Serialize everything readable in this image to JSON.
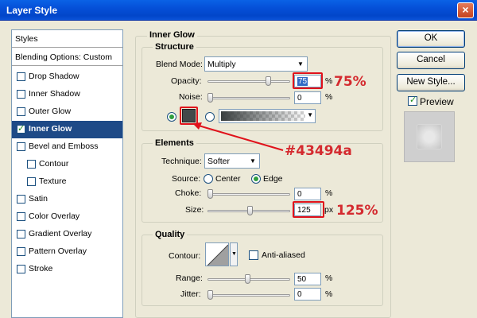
{
  "window": {
    "title": "Layer Style",
    "close_glyph": "×"
  },
  "sidebar": {
    "header": "Styles",
    "blending": "Blending Options: Custom",
    "items": [
      {
        "label": "Drop Shadow",
        "checked": false
      },
      {
        "label": "Inner Shadow",
        "checked": false
      },
      {
        "label": "Outer Glow",
        "checked": false
      },
      {
        "label": "Inner Glow",
        "checked": true
      },
      {
        "label": "Bevel and Emboss",
        "checked": false
      },
      {
        "label": "Contour",
        "checked": false
      },
      {
        "label": "Texture",
        "checked": false
      },
      {
        "label": "Satin",
        "checked": false
      },
      {
        "label": "Color Overlay",
        "checked": false
      },
      {
        "label": "Gradient Overlay",
        "checked": false
      },
      {
        "label": "Pattern Overlay",
        "checked": false
      },
      {
        "label": "Stroke",
        "checked": false
      }
    ]
  },
  "inner_glow": {
    "title": "Inner Glow",
    "structure": {
      "title": "Structure",
      "blend_mode_label": "Blend Mode:",
      "blend_mode_value": "Multiply",
      "opacity_label": "Opacity:",
      "opacity_value": "75",
      "opacity_unit": "%",
      "noise_label": "Noise:",
      "noise_value": "0",
      "noise_unit": "%",
      "glow_color": "#43494a"
    },
    "elements": {
      "title": "Elements",
      "technique_label": "Technique:",
      "technique_value": "Softer",
      "source_label": "Source:",
      "source_center": "Center",
      "source_edge": "Edge",
      "choke_label": "Choke:",
      "choke_value": "0",
      "choke_unit": "%",
      "size_label": "Size:",
      "size_value": "125",
      "size_unit": "px"
    },
    "quality": {
      "title": "Quality",
      "contour_label": "Contour:",
      "anti_aliased_label": "Anti-aliased",
      "range_label": "Range:",
      "range_value": "50",
      "range_unit": "%",
      "jitter_label": "Jitter:",
      "jitter_value": "0",
      "jitter_unit": "%"
    }
  },
  "annotations": {
    "opacity": "75%",
    "size": "125%",
    "color": "#43494a",
    "accent_color": "#d42a2f"
  },
  "buttons": {
    "ok": "OK",
    "cancel": "Cancel",
    "new_style": "New Style...",
    "preview_label": "Preview",
    "preview_checked": true
  }
}
